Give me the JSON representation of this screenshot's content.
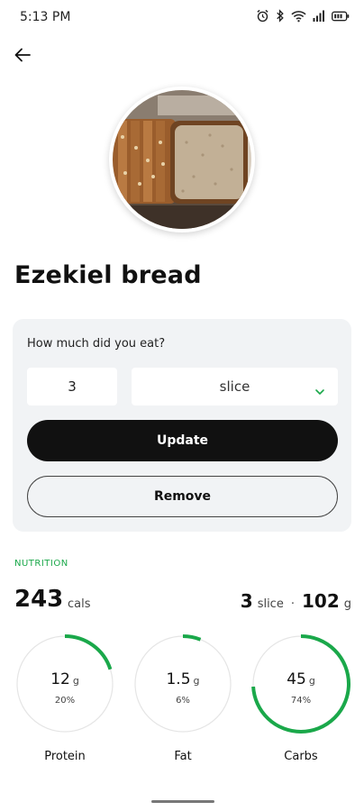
{
  "status_bar": {
    "time": "5:13 PM",
    "icons": [
      "alarm-icon",
      "bluetooth-icon",
      "wifi-icon",
      "signal-icon",
      "battery-icon"
    ]
  },
  "header": {
    "back_icon": "arrow-left-icon"
  },
  "food": {
    "name": "Ezekiel bread"
  },
  "portion": {
    "question": "How much did you eat?",
    "quantity": "3",
    "unit": "slice",
    "update_label": "Update",
    "remove_label": "Remove"
  },
  "nutrition": {
    "heading": "NUTRITION",
    "calories": "243",
    "calories_unit": "cals",
    "serving_count": "3",
    "serving_unit": "slice",
    "separator": "·",
    "weight": "102",
    "weight_unit": "g",
    "macros": [
      {
        "label": "Protein",
        "amount": "12",
        "unit": "g",
        "percent_text": "20%",
        "percent": 20
      },
      {
        "label": "Fat",
        "amount": "1.5",
        "unit": "g",
        "percent_text": "6%",
        "percent": 6
      },
      {
        "label": "Carbs",
        "amount": "45",
        "unit": "g",
        "percent_text": "74%",
        "percent": 74
      }
    ]
  },
  "colors": {
    "accent_green": "#1aa84a",
    "ring_track": "#e5e5e5",
    "button_dark": "#111111",
    "card_bg": "#f1f3f5"
  }
}
